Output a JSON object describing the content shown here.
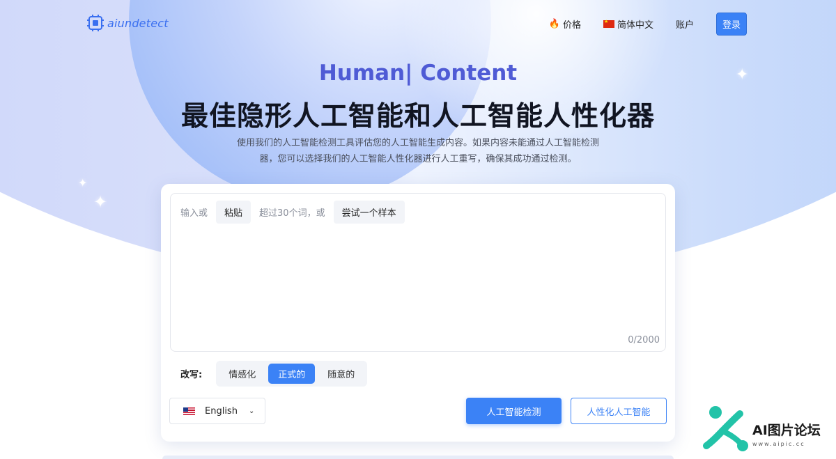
{
  "brand": {
    "name": "aiundetect",
    "color": "#3a6ff0"
  },
  "nav": {
    "pricing": {
      "icon": "fire-icon",
      "label": "价格"
    },
    "language": {
      "icon": "china-flag-icon",
      "label": "简体中文"
    },
    "account": "账户",
    "login": "登录"
  },
  "hero": {
    "subtitle": "Human| Content",
    "title": "最佳隐形人工智能和人工智能人性化器",
    "desc_line1": "使用我们的人工智能检测工具评估您的人工智能生成内容。如果内容未能通过人工智能检测",
    "desc_line2": "器，您可以选择我们的人工智能人性化器进行人工重写，确保其成功通过检测。"
  },
  "editor": {
    "hint_prefix": "输入或",
    "paste_label": "粘贴",
    "hint_middle": "超过30个词，或",
    "sample_label": "尝试一个样本",
    "counter": "0/2000"
  },
  "rewrite": {
    "label": "改写:",
    "options": [
      "情感化",
      "正式的",
      "随意的"
    ],
    "selected": "正式的"
  },
  "language_select": {
    "icon": "us-flag-icon",
    "value": "English"
  },
  "actions": {
    "detect": "人工智能检测",
    "humanize": "人性化人工智能"
  },
  "watermark": {
    "text": "AI图片论坛",
    "url": "www.aipic.cc"
  },
  "colors": {
    "accent": "#3b82f6",
    "hero_subtitle": "#4f5bd5"
  }
}
